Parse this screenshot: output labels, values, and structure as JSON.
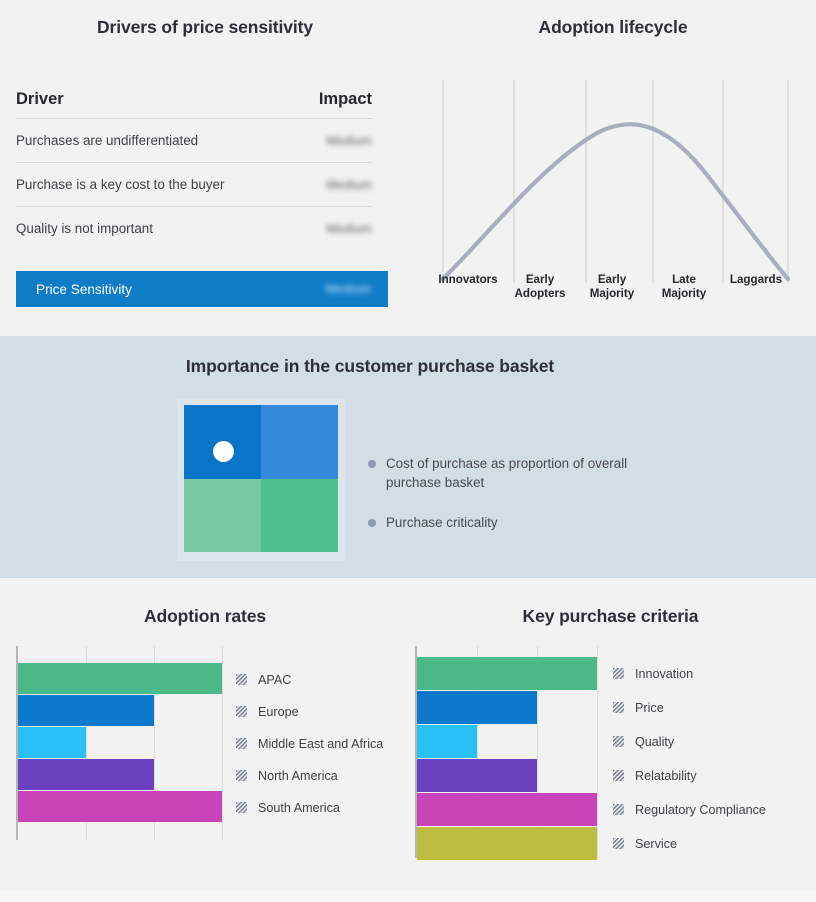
{
  "theme": {
    "bg_light": "#f2f2f2",
    "bg_band": "#d2dde6",
    "accent_blue": "#0f7cc8",
    "curve_color": "#a8aebb",
    "legend_dot": "#8d9bb0",
    "grid": "#dcdcdc"
  },
  "drivers": {
    "title": "Drivers of price sensitivity",
    "columns": {
      "driver": "Driver",
      "impact": "Impact"
    },
    "rows": [
      {
        "driver": "Purchases are undifferentiated",
        "impact": "Medium"
      },
      {
        "driver": "Purchase is a key cost to the buyer",
        "impact": "Medium"
      },
      {
        "driver": "Quality is not important",
        "impact": "Medium"
      }
    ],
    "summary": {
      "label": "Price Sensitivity",
      "impact": "Medium"
    }
  },
  "lifecycle": {
    "title": "Adoption lifecycle",
    "stages": [
      {
        "line1": "",
        "line2": "Innovators"
      },
      {
        "line1": "Early",
        "line2": "Adopters"
      },
      {
        "line1": "Early",
        "line2": "Majority"
      },
      {
        "line1": "Late",
        "line2": "Majority"
      },
      {
        "line1": "",
        "line2": "Laggards"
      }
    ]
  },
  "basket": {
    "title": "Importance in the customer purchase basket",
    "matrix": {
      "quadrants": [
        {
          "name": "top-left",
          "color": "#0a74c8"
        },
        {
          "name": "top-right",
          "color": "#3389db"
        },
        {
          "name": "bottom-left",
          "color": "#76c9a4"
        },
        {
          "name": "bottom-right",
          "color": "#4cbe8d"
        }
      ],
      "marker": "position-dot"
    },
    "legend": [
      "Cost of purchase as proportion of overall purchase basket",
      "Purchase criticality"
    ]
  },
  "chart_data": [
    {
      "type": "bar",
      "orientation": "horizontal",
      "title": "Adoption rates",
      "xlabel": "",
      "ylabel": "",
      "xlim": [
        0,
        3
      ],
      "grid": true,
      "gridlines": [
        1,
        2,
        3
      ],
      "legend_position": "right",
      "categories": [
        "APAC",
        "Europe",
        "Middle East and Africa",
        "North America",
        "South America"
      ],
      "values": [
        3,
        2,
        1,
        2,
        3
      ],
      "colors": [
        "#4bb98a",
        "#0c79cd",
        "#29c0f5",
        "#6a42c0",
        "#c944b8"
      ]
    },
    {
      "type": "bar",
      "orientation": "horizontal",
      "title": "Key purchase criteria",
      "xlabel": "",
      "ylabel": "",
      "xlim": [
        0,
        3
      ],
      "grid": true,
      "gridlines": [
        1,
        2,
        3
      ],
      "legend_position": "right",
      "categories": [
        "Innovation",
        "Price",
        "Quality",
        "Relatability",
        "Regulatory Compliance",
        "Service"
      ],
      "values": [
        3,
        2,
        1,
        2,
        3,
        3
      ],
      "colors": [
        "#4bb98a",
        "#0c79cd",
        "#29c0f5",
        "#6a42c0",
        "#c944b8",
        "#bdbd3f"
      ]
    }
  ]
}
